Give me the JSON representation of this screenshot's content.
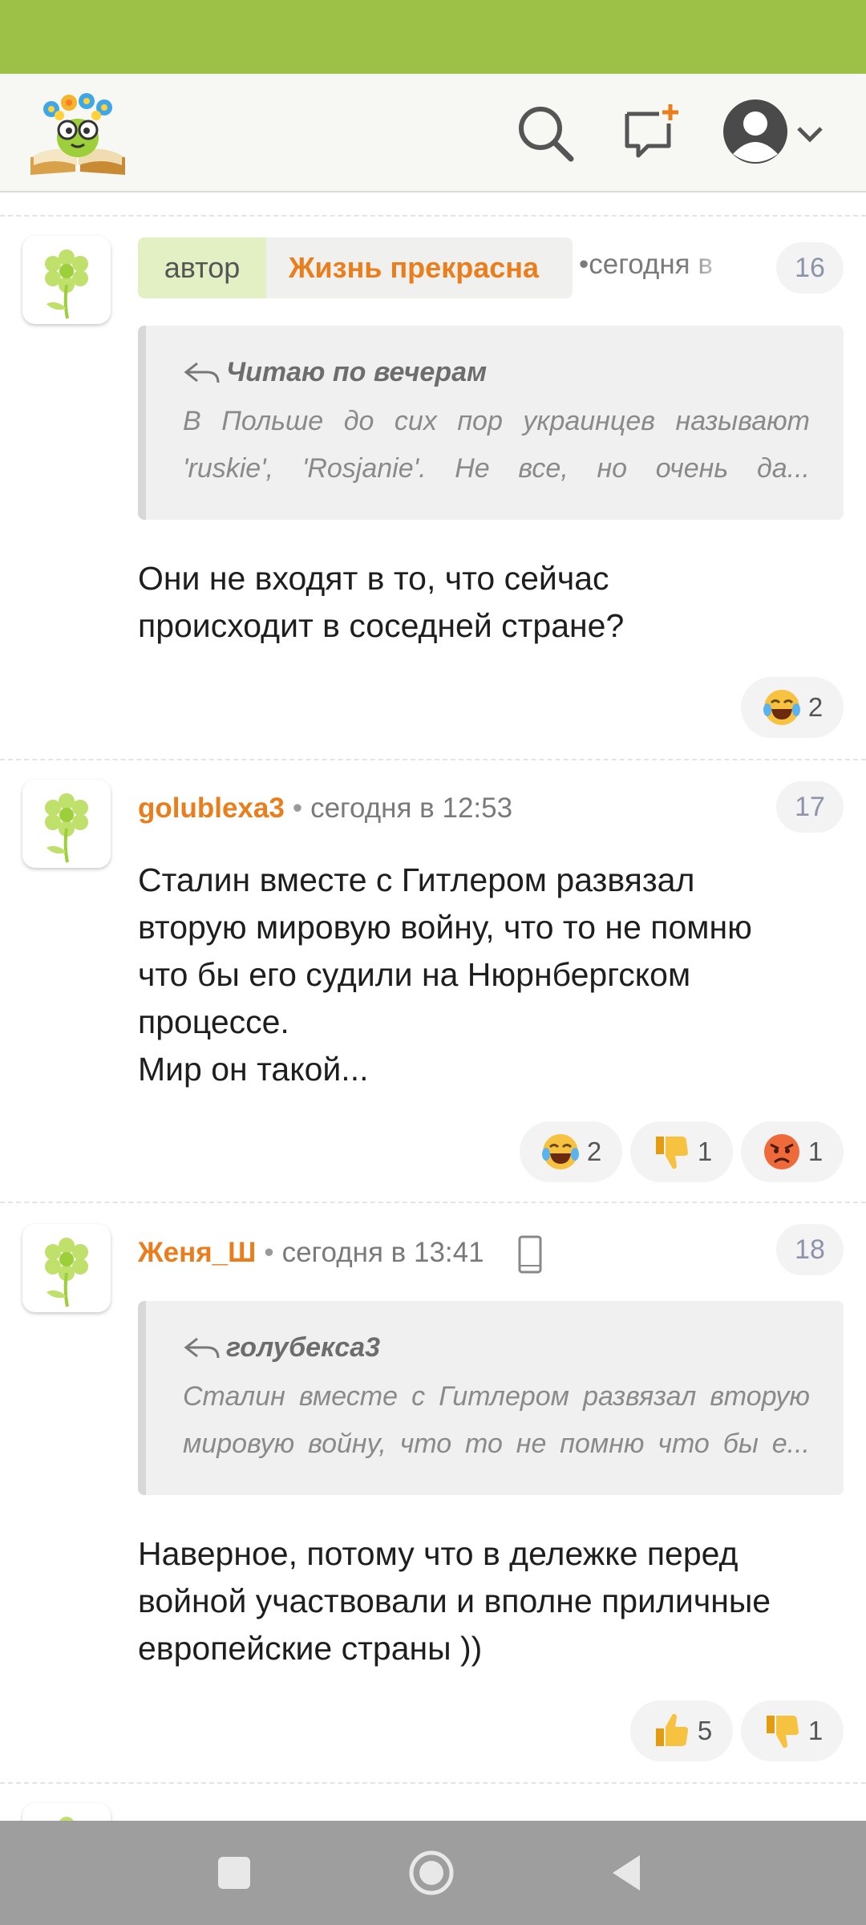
{
  "app": {
    "header": {
      "logo": "book-flowers-logo",
      "icons": [
        "search-icon",
        "new-message-icon",
        "profile-icon",
        "chevron-down-icon"
      ]
    },
    "colors": {
      "status_bar": "#9dc146",
      "accent_orange": "#ea7d1c",
      "author_badge_bg": "#e2f0c4"
    }
  },
  "comments": [
    {
      "author_label": "автор",
      "username": "Жизнь прекрасна",
      "date": "сегодня в",
      "number": "16",
      "quote": {
        "author": "Читаю по вечерам",
        "text": "В Польше до сих пор украинцев называют 'ruskie', 'Rosjanie'. Не все, но очень да..."
      },
      "text": "Они не входят в то, что сейчас\nпроисходит в соседней стране?",
      "reactions": [
        {
          "icon": "laughing-tears-emoji",
          "count": "2"
        }
      ]
    },
    {
      "username": "golublexa3",
      "date": "сегодня в 12:53",
      "number": "17",
      "text": "Сталин вместе с Гитлером развязал\nвторую мировую войну, что то не помню\nчто бы его судили на Нюрнбергском\nпроцессе.\nМир он такой...",
      "reactions": [
        {
          "icon": "laughing-tears-emoji",
          "count": "2"
        },
        {
          "icon": "thumbs-down-emoji",
          "count": "1"
        },
        {
          "icon": "angry-face-emoji",
          "count": "1"
        }
      ]
    },
    {
      "username": "Женя_Ш",
      "date": "сегодня в 13:41",
      "device_icon": "mobile-phone-icon",
      "number": "18",
      "quote": {
        "author": "голубекса3",
        "text": "Сталин вместе с Гитлером развязал вторую мировую войну, что то не помню что бы е..."
      },
      "text": "Наверное, потому что в дележке перед\nвойной участвовали и вполне приличные\nевропейские страны ))",
      "reactions": [
        {
          "icon": "thumbs-up-emoji",
          "count": "5"
        },
        {
          "icon": "thumbs-down-emoji",
          "count": "1"
        }
      ]
    }
  ],
  "nav": {
    "buttons": [
      "recents-button",
      "home-button",
      "back-button"
    ]
  }
}
